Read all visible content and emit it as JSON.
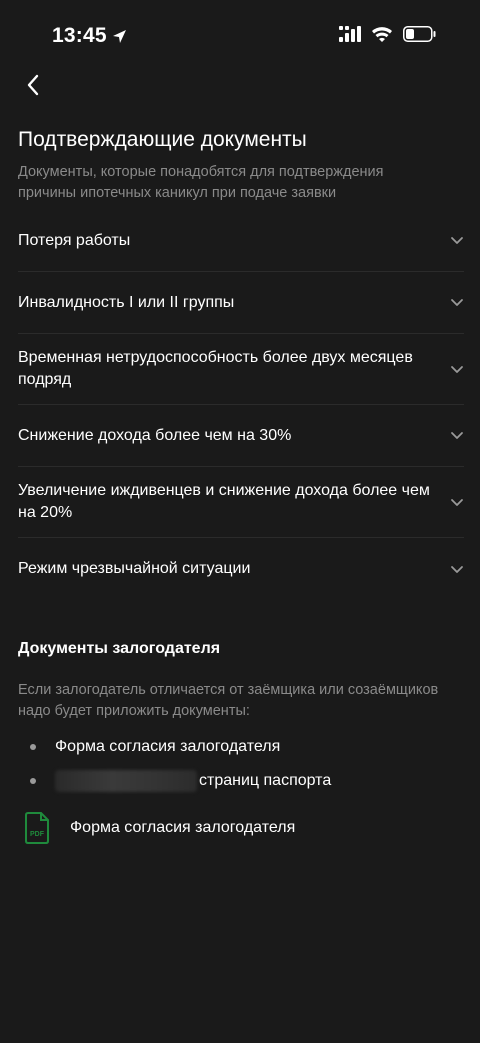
{
  "status_bar": {
    "time": "13:45"
  },
  "page": {
    "title": "Подтверждающие документы",
    "subtitle": "Документы, которые понадобятся для подтверждения причины ипотечных каникул при подаче заявки"
  },
  "accordion": {
    "items": [
      {
        "label": "Потеря работы"
      },
      {
        "label": "Инвалидность I или II группы"
      },
      {
        "label": "Временная нетрудоспособность более двух месяцев подряд"
      },
      {
        "label": "Снижение дохода более чем на 30%"
      },
      {
        "label": "Увеличение иждивенцев и снижение дохода более чем на 20%"
      },
      {
        "label": "Режим чрезвычайной ситуации"
      }
    ]
  },
  "pledger": {
    "title": "Документы залогодателя",
    "text": "Если залогодатель отличается от заёмщика или созаёмщиков надо будет приложить документы:",
    "bullets": [
      {
        "text": "Форма согласия залогодателя"
      },
      {
        "text": "страниц паспорта"
      }
    ],
    "file": {
      "icon_text": "PDF",
      "label": "Форма согласия залогодателя"
    }
  },
  "colors": {
    "background": "#1a1a1a",
    "secondary_text": "#8a8a8a",
    "divider": "#2b2b2b",
    "pdf_green": "#1f8a3c"
  }
}
